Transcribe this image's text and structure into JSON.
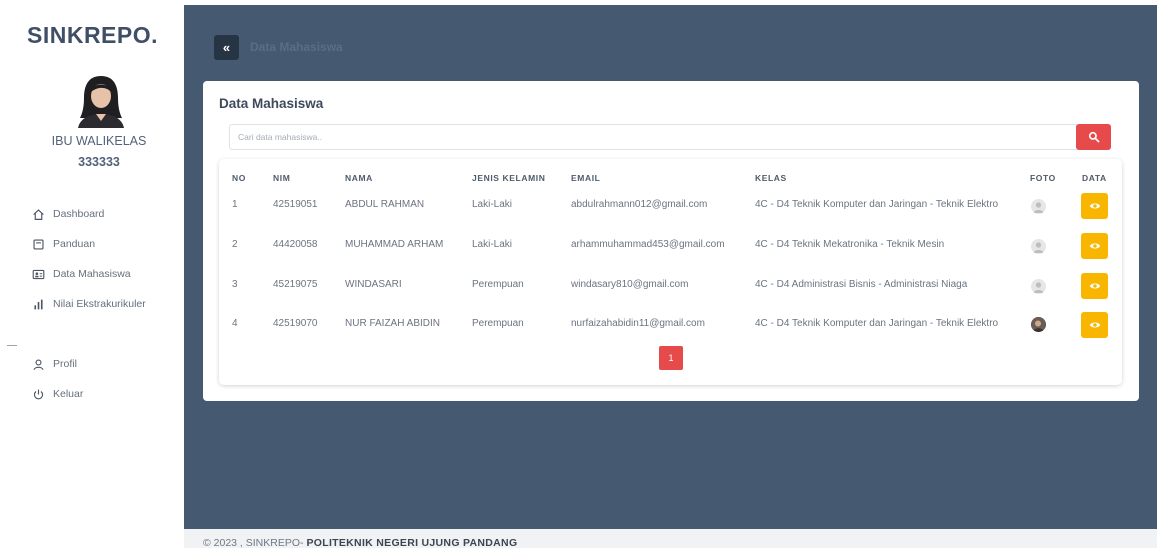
{
  "app": {
    "brand": "SINKREPO."
  },
  "user": {
    "role": "IBU WALIKELAS",
    "id": "333333"
  },
  "sidebar": {
    "items": [
      {
        "label": "Dashboard",
        "icon": "home-icon"
      },
      {
        "label": "Panduan",
        "icon": "book-icon"
      },
      {
        "label": "Data Mahasiswa",
        "icon": "id-card-icon"
      },
      {
        "label": "Nilai Ekstrakurikuler",
        "icon": "bar-chart-icon"
      }
    ],
    "bottom_items": [
      {
        "label": "Profil",
        "icon": "user-icon"
      },
      {
        "label": "Keluar",
        "icon": "power-icon"
      }
    ]
  },
  "header": {
    "toggle_label": "«",
    "page_heading": "Data Mahasiswa"
  },
  "card": {
    "title": "Data Mahasiswa",
    "search_placeholder": "Cari data mahasiswa..",
    "search_value": ""
  },
  "table": {
    "headers": [
      "NO",
      "NIM",
      "NAMA",
      "JENIS KELAMIN",
      "EMAIL",
      "KELAS",
      "FOTO",
      "DATA"
    ],
    "rows": [
      {
        "no": "1",
        "nim": "42519051",
        "nama": "ABDUL RAHMAN",
        "jk": "Laki-Laki",
        "email": "abdulrahmann012@gmail.com",
        "kelas": "4C - D4 Teknik Komputer dan Jaringan - Teknik Elektro",
        "foto": "placeholder"
      },
      {
        "no": "2",
        "nim": "44420058",
        "nama": "MUHAMMAD ARHAM",
        "jk": "Laki-Laki",
        "email": "arhammuhammad453@gmail.com",
        "kelas": "4C - D4 Teknik Mekatronika - Teknik Mesin",
        "foto": "placeholder"
      },
      {
        "no": "3",
        "nim": "45219075",
        "nama": "WINDASARI",
        "jk": "Perempuan",
        "email": "windasary810@gmail.com",
        "kelas": "4C - D4 Administrasi Bisnis - Administrasi Niaga",
        "foto": "placeholder"
      },
      {
        "no": "4",
        "nim": "42519070",
        "nama": "NUR FAIZAH ABIDIN",
        "jk": "Perempuan",
        "email": "nurfaizahabidin11@gmail.com",
        "kelas": "4C - D4 Teknik Komputer dan Jaringan - Teknik Elektro",
        "foto": "photo"
      }
    ]
  },
  "pagination": {
    "current": "1"
  },
  "footer": {
    "prefix": "© 2023 , SINKREPO- ",
    "org": "POLITEKNIK NEGERI UJUNG PANDANG"
  },
  "colors": {
    "main_bg": "#455a71",
    "danger": "#e74a4a",
    "warning": "#f8b600",
    "brand": "#3f4f67"
  }
}
